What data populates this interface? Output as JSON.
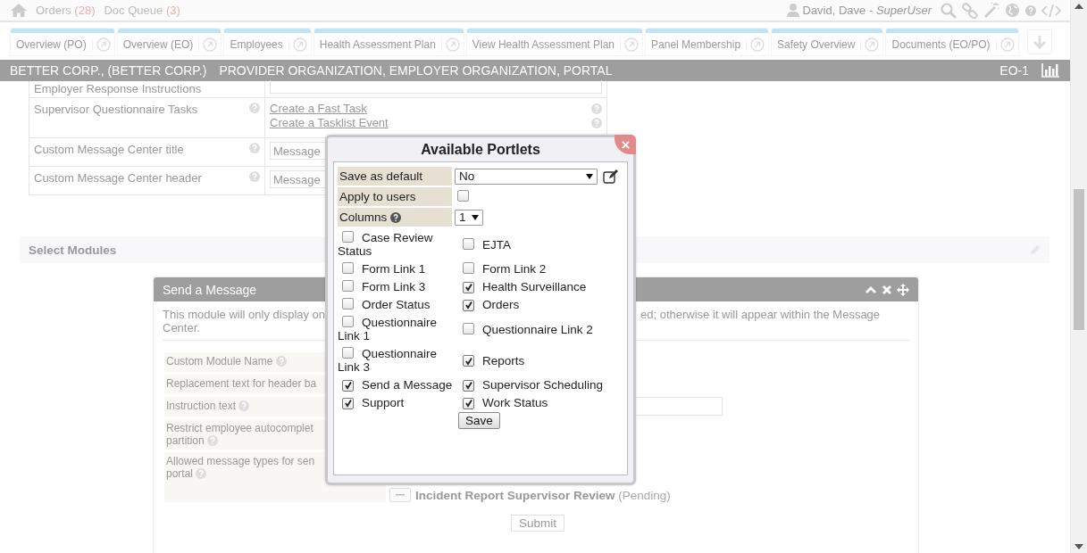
{
  "top_bar": {
    "nav": [
      {
        "label": "Orders",
        "count": "(28)"
      },
      {
        "label": "Doc Queue",
        "count": "(3)"
      }
    ],
    "user": {
      "name": "David, Dave -",
      "role": "SuperUser"
    }
  },
  "tabs": [
    {
      "label": "Overview (PO)",
      "selected": false
    },
    {
      "label": "Overview (EO)",
      "selected": false
    },
    {
      "label": "Employees",
      "selected": false
    },
    {
      "label": "Health Assessment Plan",
      "selected": false
    },
    {
      "label": "View Health Assessment Plan",
      "selected": false
    },
    {
      "label": "Panel Membership",
      "selected": false
    },
    {
      "label": "Safety Overview",
      "selected": false
    },
    {
      "label": "Documents (EO/PO)",
      "selected": false
    }
  ],
  "org_bar": {
    "name": "BETTER CORP., (BETTER CORP.)",
    "roles": "PROVIDER ORGANIZATION, EMPLOYER ORGANIZATION, PORTAL",
    "code": "EO-1"
  },
  "settings_form": {
    "rows": [
      {
        "kind": "textarea",
        "label": "Employer Response Instructions"
      },
      {
        "kind": "links",
        "label": "Supervisor Questionnaire Tasks",
        "links": [
          "Create a Fast Task",
          "Create a Tasklist Event"
        ]
      },
      {
        "kind": "input",
        "label": "Custom Message Center title",
        "placeholder": "Message"
      },
      {
        "kind": "input",
        "label": "Custom Message Center header",
        "placeholder": "Message"
      }
    ]
  },
  "section": {
    "title": "Select Modules"
  },
  "module": {
    "title": "Send a Message",
    "description_left": "This module will only display on",
    "description_right": "ed; otherwise it will appear within the Message",
    "description_end": "Center.",
    "fields": [
      {
        "label": "Custom Module Name",
        "help": true
      },
      {
        "label": "Replacement text for header ba",
        "help": false
      },
      {
        "label": "Instruction text",
        "help": true,
        "kind": "textarea"
      },
      {
        "label": "Restrict employee autocomplet",
        "label_2": "partition",
        "help": true
      },
      {
        "label": "Allowed message types for sen",
        "label_2": "portal",
        "help": true,
        "kind": "types"
      }
    ],
    "message_types": [
      {
        "name": "Incident Report Supervisor Review",
        "status": "(Pending)"
      }
    ],
    "submit": "Submit"
  },
  "dialog": {
    "title": "Available Portlets",
    "settings": [
      {
        "kind": "select",
        "label": "Save as default",
        "value": "No"
      },
      {
        "kind": "checkbox",
        "label": "Apply to users",
        "checked": false
      },
      {
        "kind": "select",
        "label": "Columns",
        "value": "1",
        "help": true
      }
    ],
    "portlets": [
      {
        "label": "Case Review Status",
        "checked": false
      },
      {
        "label": "EJTA",
        "checked": false
      },
      {
        "label": "Form Link 1",
        "checked": false
      },
      {
        "label": "Form Link 2",
        "checked": false
      },
      {
        "label": "Form Link 3",
        "checked": false
      },
      {
        "label": "Health Surveillance",
        "checked": true
      },
      {
        "label": "Order Status",
        "checked": false
      },
      {
        "label": "Orders",
        "checked": true
      },
      {
        "label": "Questionnaire Link 1",
        "checked": false
      },
      {
        "label": "Questionnaire Link 2",
        "checked": false
      },
      {
        "label": "Questionnaire Link 3",
        "checked": false
      },
      {
        "label": "Reports",
        "checked": true
      },
      {
        "label": "Send a Message",
        "checked": true
      },
      {
        "label": "Supervisor Scheduling",
        "checked": true
      },
      {
        "label": "Support",
        "checked": true
      },
      {
        "label": "Work Status",
        "checked": true
      }
    ],
    "save": "Save"
  }
}
